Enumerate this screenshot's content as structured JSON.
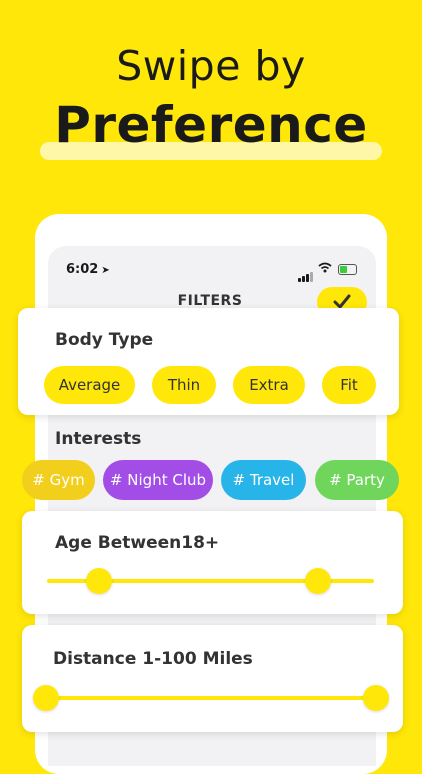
{
  "headline": {
    "line1": "Swipe by",
    "line2": "Preference"
  },
  "status_bar": {
    "time": "6:02",
    "location_icon": "location-arrow-icon",
    "signal_icon": "cellular-signal-icon",
    "wifi_icon": "wifi-icon",
    "battery_icon": "battery-charging-icon"
  },
  "filters": {
    "title": "FILTERS",
    "confirm_icon": "checkmark-icon"
  },
  "body_type": {
    "title": "Body Type",
    "options": [
      "Average",
      "Thin",
      "Extra",
      "Fit"
    ]
  },
  "interests": {
    "title": "Interests",
    "tags": [
      {
        "label": "# Gym",
        "color": "#F2CF1D"
      },
      {
        "label": "# Night Club",
        "color": "#A24DE6"
      },
      {
        "label": "# Travel",
        "color": "#27B4E8"
      },
      {
        "label": "# Party",
        "color": "#6FD65B"
      }
    ]
  },
  "age": {
    "title": "Age Between18+",
    "range_low_fraction": 0.16,
    "range_high_fraction": 0.83
  },
  "distance": {
    "title": "Distance 1-100 Miles",
    "range_low_fraction": 0.0,
    "range_high_fraction": 1.0
  },
  "colors": {
    "brand_yellow": "#FFE70A",
    "highlight": "#FFF7A8"
  }
}
